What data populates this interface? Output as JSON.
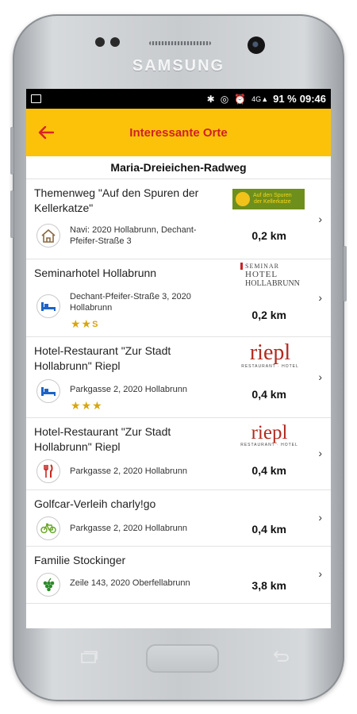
{
  "device": {
    "brand": "SAMSUNG"
  },
  "statusbar": {
    "network": "4G",
    "battery": "91 %",
    "time": "09:46"
  },
  "appbar": {
    "title": "Interessante Orte"
  },
  "section_title": "Maria-Dreieichen-Radweg",
  "items": [
    {
      "title": "Themenweg \"Auf den Spuren der Kellerkatze\"",
      "address": "Navi: 2020 Hollabrunn, Dechant-Pfeifer-Straße 3",
      "distance": "0,2 km",
      "icon": "house-icon",
      "logo": {
        "line1": "Auf den Spuren",
        "line2": "der Kellerkatze"
      }
    },
    {
      "title": "Seminarhotel Hollabrunn",
      "address": "Dechant-Pfeifer-Straße 3, 2020 Hollabrunn",
      "distance": "0,2 km",
      "icon": "bed-icon",
      "stars": "★★",
      "stars_sup": "S",
      "logo": {
        "line1": "SEMINAR",
        "line2": "HOTEL",
        "line3": "HOLLABRUNN"
      }
    },
    {
      "title": "Hotel-Restaurant \"Zur Stadt Hollabrunn\" Riepl",
      "address": "Parkgasse 2, 2020 Hollabrunn",
      "distance": "0,4 km",
      "icon": "bed-icon",
      "stars": "★★★",
      "logo": {
        "name": "riepl",
        "sub": "RESTAURANT · HOTEL"
      }
    },
    {
      "title": "Hotel-Restaurant \"Zur Stadt Hollabrunn\" Riepl",
      "address": "Parkgasse 2, 2020 Hollabrunn",
      "distance": "0,4 km",
      "icon": "fork-knife-icon",
      "logo": {
        "name": "riepl",
        "sub": "RESTAURANT · HOTEL"
      }
    },
    {
      "title": "Golfcar-Verleih charly!go",
      "address": "Parkgasse 2, 2020 Hollabrunn",
      "distance": "0,4 km",
      "icon": "bicycle-icon"
    },
    {
      "title": "Familie Stockinger",
      "address": "Zeile 143, 2020 Oberfellabrunn",
      "distance": "3,8 km",
      "icon": "grapes-icon"
    }
  ],
  "colors": {
    "appbar": "#fcc20a",
    "title": "#cf2127",
    "stars": "#d7a60e",
    "icon_blue": "#1f63c6"
  }
}
